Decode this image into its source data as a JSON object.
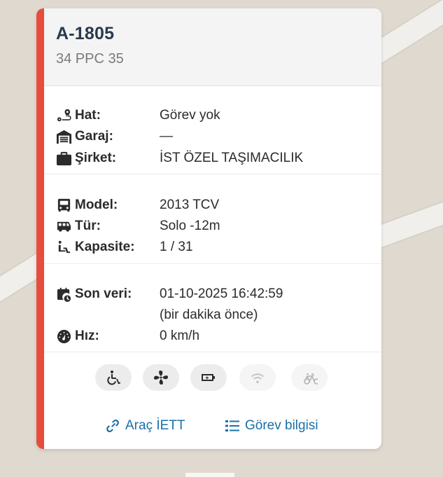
{
  "vehicle": {
    "code": "A-1805",
    "plate": "34 PPC 35"
  },
  "info": {
    "hat_label": "Hat:",
    "hat_value": "Görev yok",
    "garaj_label": "Garaj:",
    "garaj_value": "—",
    "sirket_label": "Şirket:",
    "sirket_value": "İST ÖZEL TAŞIMACILIK",
    "model_label": "Model:",
    "model_value": "2013 TCV",
    "tur_label": "Tür:",
    "tur_value": "Solo -12m",
    "kapasite_label": "Kapasite:",
    "kapasite_value": "1 / 31",
    "sonveri_label": "Son veri:",
    "sonveri_value": "01-10-2025 16:42:59",
    "sonveri_relative": "(bir dakika önce)",
    "hiz_label": "Hız:",
    "hiz_value": "0 km/h"
  },
  "features": [
    {
      "icon": "wheelchair-icon",
      "active": true
    },
    {
      "icon": "air-conditioning-icon",
      "active": true
    },
    {
      "icon": "usb-charger-icon",
      "active": true
    },
    {
      "icon": "wifi-icon",
      "active": false
    },
    {
      "icon": "bicycle-icon",
      "active": false
    }
  ],
  "links": {
    "arac_label": "Araç İETT",
    "gorev_label": "Görev bilgisi"
  },
  "colors": {
    "accent": "#e84c3d",
    "link": "#1a6fa8",
    "title": "#2a3a4e"
  }
}
